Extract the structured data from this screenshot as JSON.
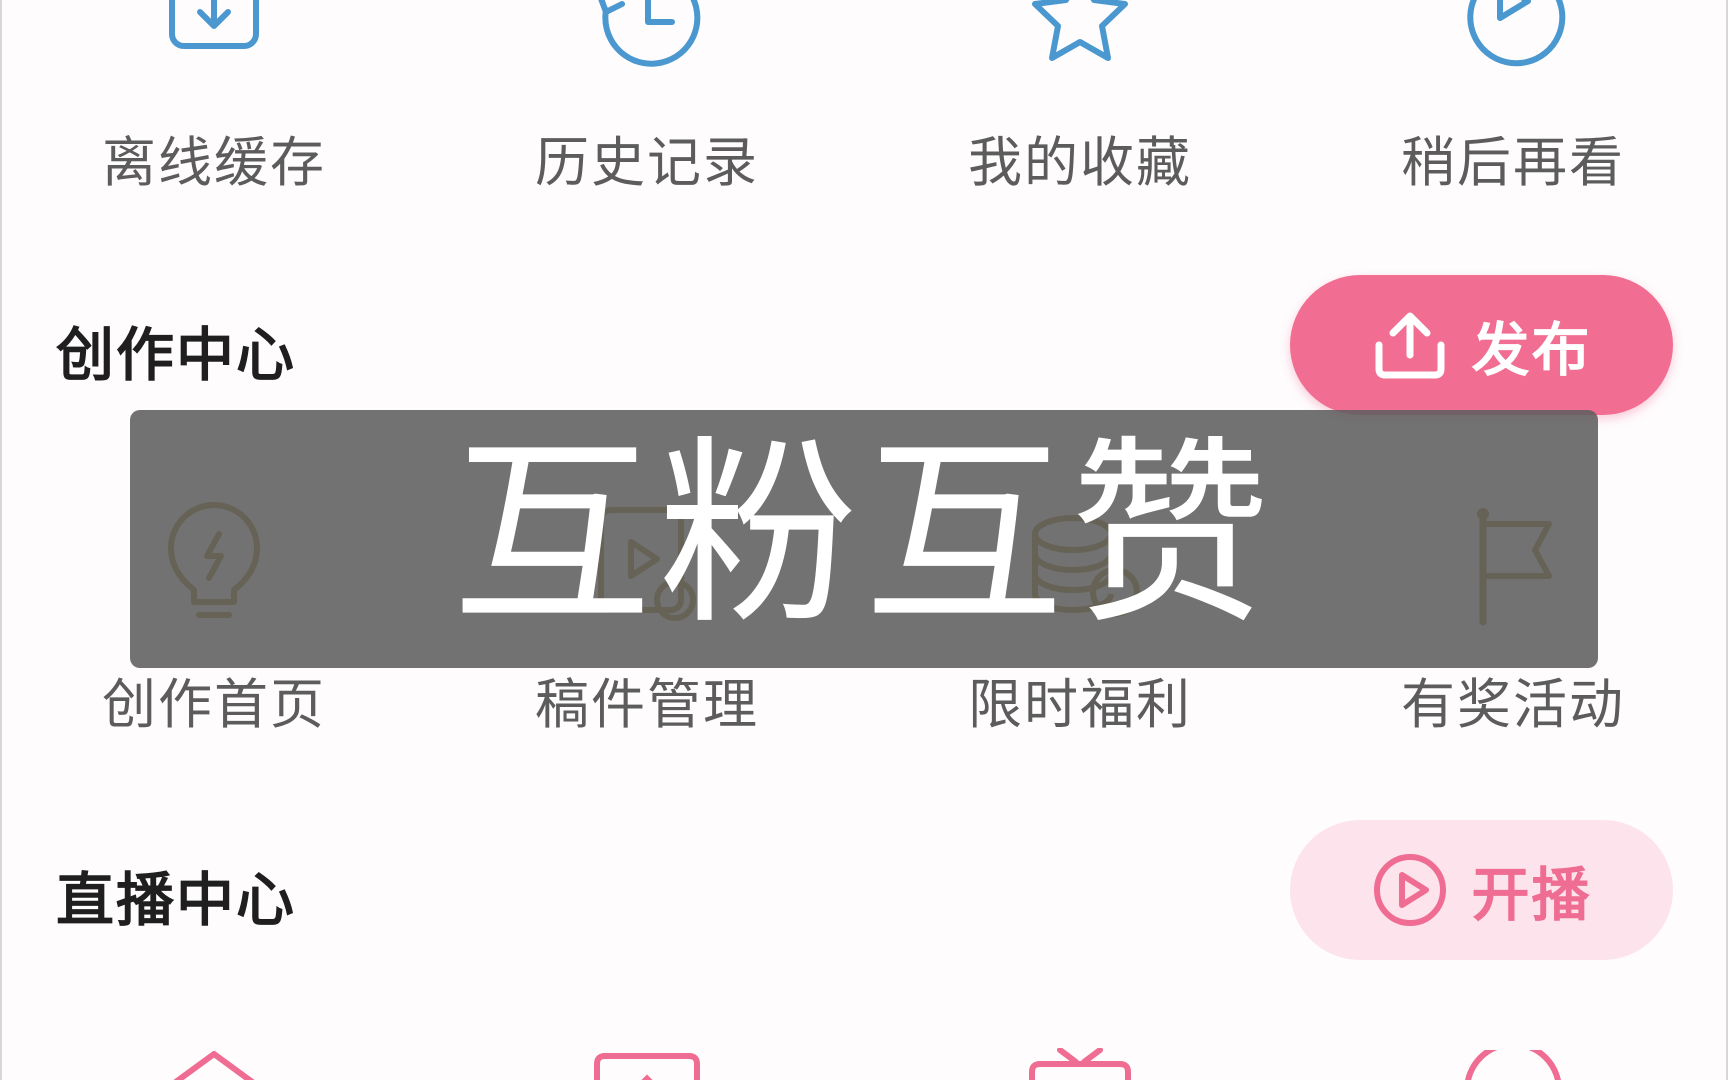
{
  "quick_access": {
    "items": [
      {
        "label": "离线缓存",
        "icon": "download-icon"
      },
      {
        "label": "历史记录",
        "icon": "history-clock-icon"
      },
      {
        "label": "我的收藏",
        "icon": "star-icon"
      },
      {
        "label": "稍后再看",
        "icon": "watch-later-icon"
      }
    ]
  },
  "creation_center": {
    "title": "创作中心",
    "publish_button": {
      "label": "发布",
      "icon": "upload-icon"
    },
    "items": [
      {
        "label": "创作首页",
        "icon": "lightbulb-icon"
      },
      {
        "label": "稿件管理",
        "icon": "manuscript-icon"
      },
      {
        "label": "限时福利",
        "icon": "coins-icon"
      },
      {
        "label": "有奖活动",
        "icon": "flag-icon"
      }
    ]
  },
  "live_center": {
    "title": "直播中心",
    "start_live_button": {
      "label": "开播",
      "icon": "play-circle-icon"
    },
    "items": [
      {
        "icon": "home-icon"
      },
      {
        "icon": "screen-icon"
      },
      {
        "icon": "tv-icon"
      },
      {
        "icon": "circle-icon"
      }
    ]
  },
  "overlay": {
    "text": "互粉互赞"
  },
  "colors": {
    "accent_pink": "#f16e92",
    "pink_light": "#fde3ec",
    "icon_blue": "#4a98cf",
    "icon_gold": "#9a7b1c",
    "icon_pink": "#ef6d92",
    "label_gray": "#5c5c5c",
    "title_dark": "#1f1f1f"
  }
}
